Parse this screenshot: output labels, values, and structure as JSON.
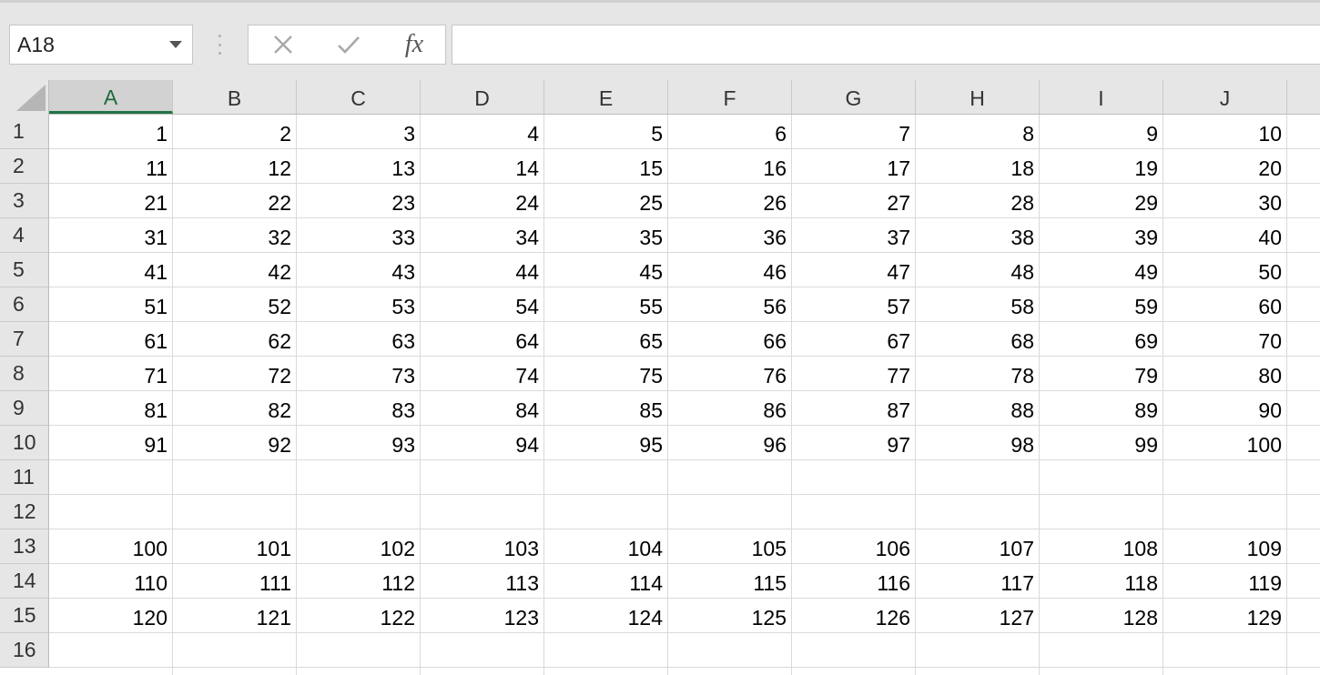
{
  "name_box": {
    "value": "A18"
  },
  "formula_bar": {
    "cancel_icon": "x-icon",
    "enter_icon": "check-icon",
    "fx_label": "fx",
    "value": ""
  },
  "columns": [
    "A",
    "B",
    "C",
    "D",
    "E",
    "F",
    "G",
    "H",
    "I",
    "J"
  ],
  "active_column": "A",
  "row_numbers": [
    "1",
    "2",
    "3",
    "4",
    "5",
    "6",
    "7",
    "8",
    "9",
    "10",
    "11",
    "12",
    "13",
    "14",
    "15",
    "16"
  ],
  "rows": [
    [
      "1",
      "2",
      "3",
      "4",
      "5",
      "6",
      "7",
      "8",
      "9",
      "10"
    ],
    [
      "11",
      "12",
      "13",
      "14",
      "15",
      "16",
      "17",
      "18",
      "19",
      "20"
    ],
    [
      "21",
      "22",
      "23",
      "24",
      "25",
      "26",
      "27",
      "28",
      "29",
      "30"
    ],
    [
      "31",
      "32",
      "33",
      "34",
      "35",
      "36",
      "37",
      "38",
      "39",
      "40"
    ],
    [
      "41",
      "42",
      "43",
      "44",
      "45",
      "46",
      "47",
      "48",
      "49",
      "50"
    ],
    [
      "51",
      "52",
      "53",
      "54",
      "55",
      "56",
      "57",
      "58",
      "59",
      "60"
    ],
    [
      "61",
      "62",
      "63",
      "64",
      "65",
      "66",
      "67",
      "68",
      "69",
      "70"
    ],
    [
      "71",
      "72",
      "73",
      "74",
      "75",
      "76",
      "77",
      "78",
      "79",
      "80"
    ],
    [
      "81",
      "82",
      "83",
      "84",
      "85",
      "86",
      "87",
      "88",
      "89",
      "90"
    ],
    [
      "91",
      "92",
      "93",
      "94",
      "95",
      "96",
      "97",
      "98",
      "99",
      "100"
    ],
    [
      "",
      "",
      "",
      "",
      "",
      "",
      "",
      "",
      "",
      ""
    ],
    [
      "",
      "",
      "",
      "",
      "",
      "",
      "",
      "",
      "",
      ""
    ],
    [
      "100",
      "101",
      "102",
      "103",
      "104",
      "105",
      "106",
      "107",
      "108",
      "109"
    ],
    [
      "110",
      "111",
      "112",
      "113",
      "114",
      "115",
      "116",
      "117",
      "118",
      "119"
    ],
    [
      "120",
      "121",
      "122",
      "123",
      "124",
      "125",
      "126",
      "127",
      "128",
      "129"
    ],
    [
      "",
      "",
      "",
      "",
      "",
      "",
      "",
      "",
      "",
      ""
    ]
  ],
  "colors": {
    "accent": "#217346",
    "header_bg": "#e6e6e6",
    "gridline": "#dadada"
  }
}
